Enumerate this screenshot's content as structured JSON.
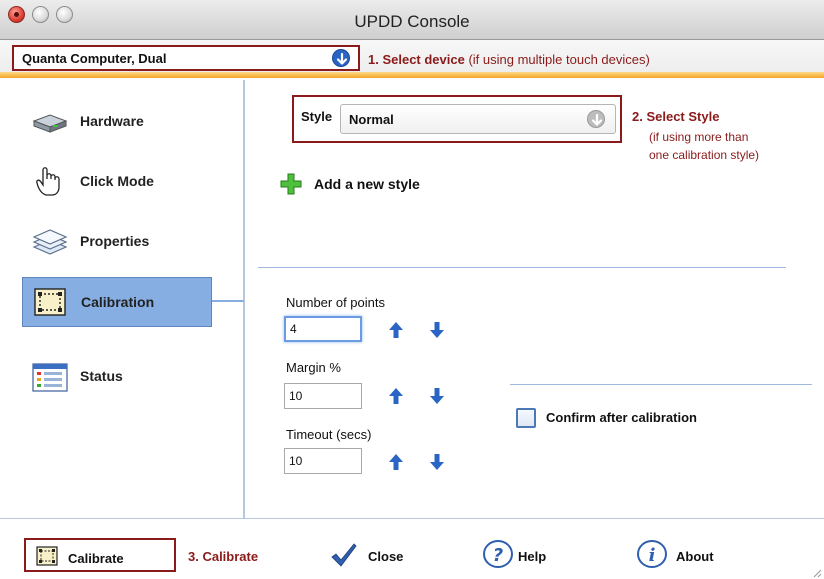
{
  "window": {
    "title": "UPDD Console"
  },
  "device": {
    "selected": "Quanta Computer, Dual",
    "step_label": "1. Select device",
    "step_hint": "(if using multiple touch devices)"
  },
  "sidebar": {
    "items": [
      {
        "label": "Hardware",
        "icon": "hardware-icon"
      },
      {
        "label": "Click Mode",
        "icon": "hand-pointer-icon"
      },
      {
        "label": "Properties",
        "icon": "layers-icon"
      },
      {
        "label": "Calibration",
        "icon": "calibration-icon",
        "active": true
      },
      {
        "label": "Status",
        "icon": "status-list-icon"
      }
    ]
  },
  "style": {
    "label": "Style",
    "selected": "Normal",
    "step_label": "2. Select Style",
    "step_hint_line1": "(if using more than",
    "step_hint_line2": "one calibration style)",
    "add_label": "Add a new style"
  },
  "calibration": {
    "points": {
      "label": "Number of points",
      "value": "4"
    },
    "margin": {
      "label": "Margin %",
      "value": "10"
    },
    "timeout": {
      "label": "Timeout (secs)",
      "value": "10"
    },
    "confirm_label": "Confirm after calibration",
    "confirm_checked": false
  },
  "footer": {
    "calibrate_label": "Calibrate",
    "calibrate_step": "3. Calibrate",
    "close_label": "Close",
    "help_label": "Help",
    "about_label": "About"
  },
  "colors": {
    "accent_red": "#8b1a1a",
    "selection_blue": "#86aee3",
    "arrow_blue": "#2a64c4"
  }
}
